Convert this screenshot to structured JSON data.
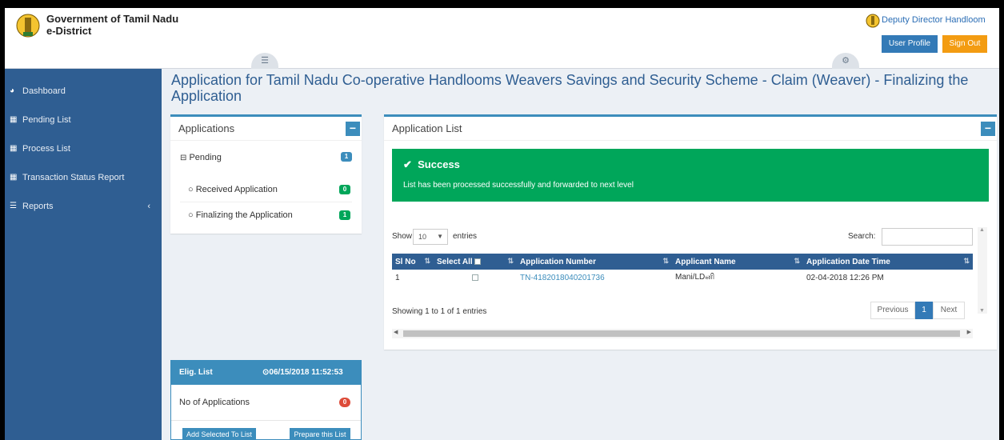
{
  "header": {
    "org_title": "Government of Tamil Nadu",
    "org_subtitle": "e-District",
    "user_name": "Deputy Director Handloom",
    "user_profile_label": "User Profile",
    "sign_out_label": "Sign Out",
    "menu_icon": "hamburger-icon",
    "settings_icon": "cogs-icon"
  },
  "sidebar": {
    "items": [
      {
        "label": "Dashboard",
        "icon": "dashboard-icon"
      },
      {
        "label": "Pending List",
        "icon": "grid-icon"
      },
      {
        "label": "Process List",
        "icon": "grid-icon"
      },
      {
        "label": "Transaction Status Report",
        "icon": "grid-icon"
      },
      {
        "label": "Reports",
        "icon": "list-icon",
        "chevron": "‹"
      }
    ]
  },
  "page": {
    "title": "Application for Tamil Nadu Co-operative Handlooms Weavers Savings and Security Scheme - Claim (Weaver) - Finalizing the Application"
  },
  "applications": {
    "title": "Applications",
    "collapse": "−",
    "pending_label": "Pending",
    "pending_count": "1",
    "items": [
      {
        "label": "Received Application",
        "count": "0"
      },
      {
        "label": "Finalizing the Application",
        "count": "1"
      }
    ]
  },
  "app_list": {
    "title": "Application List",
    "collapse": "−",
    "success_title": "Success",
    "success_message": "List has been processed successfully and forwarded to next level",
    "show_label": "Show",
    "entries_value": "10",
    "entries_label": "entries",
    "search_label": "Search:",
    "search_value": "",
    "columns": [
      "Sl No",
      "Select All",
      "Application Number",
      "Applicant Name",
      "Application Date Time"
    ],
    "rows": [
      {
        "sl_no": "1",
        "app_number": "TN-4182018040201736",
        "applicant": "Mani/LDனி",
        "date_time": "02-04-2018 12:26 PM"
      }
    ],
    "info": "Showing 1 to 1 of 1 entries",
    "prev_label": "Previous",
    "page_label": "1",
    "next_label": "Next"
  },
  "elig": {
    "title": "Elig. List",
    "timestamp": "06/15/2018 11:52:53",
    "count_label": "No of Applications",
    "count": "0",
    "add_label": "Add Selected To List",
    "prepare_label": "Prepare this List"
  },
  "colors": {
    "sidebar": "#2f5e92",
    "primary": "#3c8dbc",
    "success": "#00a65a",
    "warning": "#f39c12",
    "danger": "#dd4b39"
  }
}
